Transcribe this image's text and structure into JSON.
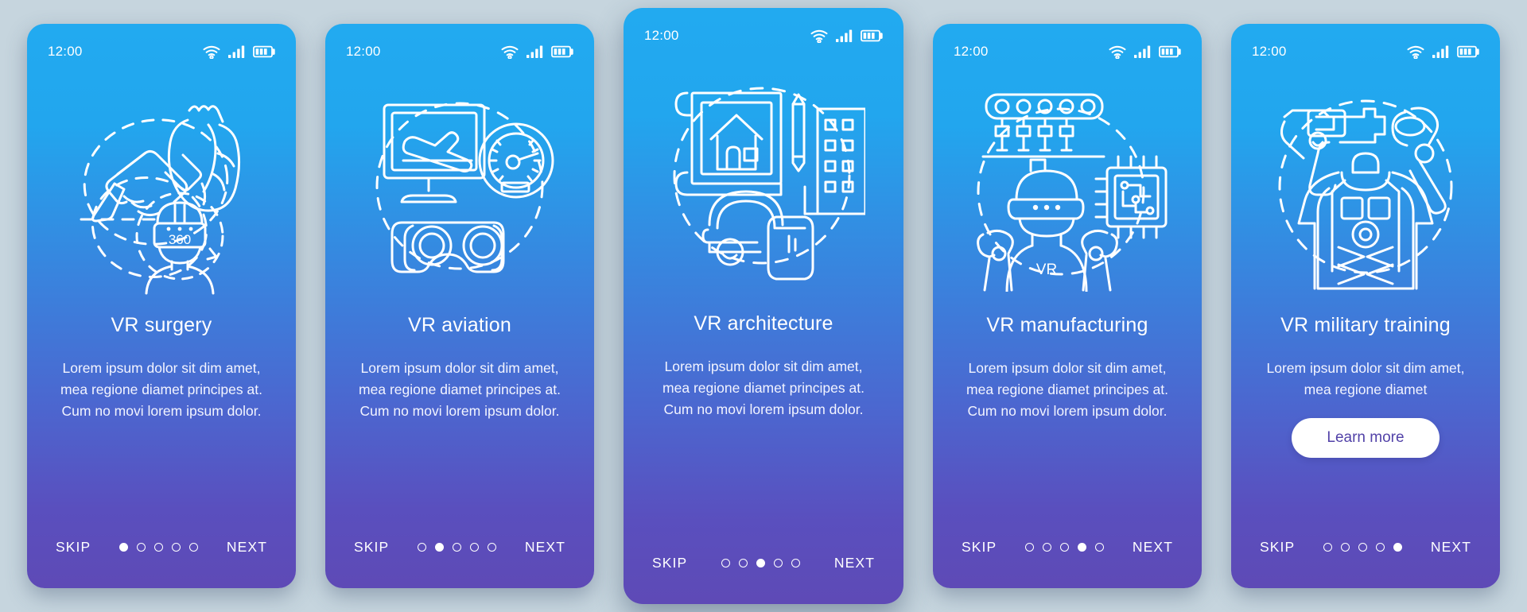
{
  "background_color": "#c6d5de",
  "status_bar": {
    "time": "12:00",
    "wifi_icon": "wifi-icon",
    "signal_icon": "signal-bars-icon",
    "battery_icon": "battery-icon"
  },
  "footer": {
    "skip_label": "SKIP",
    "next_label": "NEXT",
    "total_dots": 5
  },
  "cards": [
    {
      "id": "vr-surgery",
      "title": "VR surgery",
      "body": "Lorem ipsum dolor sit dim amet, mea regione diamet principes at. Cum no movi lorem ipsum dolor.",
      "active_dot": 1,
      "featured": false,
      "illustration": "vr-surgery-illustration",
      "illustration_label": "360",
      "cta": null
    },
    {
      "id": "vr-aviation",
      "title": "VR aviation",
      "body": "Lorem ipsum dolor sit dim amet, mea regione diamet principes at. Cum no movi lorem ipsum dolor.",
      "active_dot": 2,
      "featured": false,
      "illustration": "vr-aviation-illustration",
      "illustration_label": "",
      "cta": null
    },
    {
      "id": "vr-architecture",
      "title": "VR architecture",
      "body": "Lorem ipsum dolor sit dim amet, mea regione diamet principes at. Cum no movi lorem ipsum dolor.",
      "active_dot": 3,
      "featured": true,
      "illustration": "vr-architecture-illustration",
      "illustration_label": "",
      "cta": null
    },
    {
      "id": "vr-manufacturing",
      "title": "VR manufacturing",
      "body": "Lorem ipsum dolor sit dim amet, mea regione diamet principes at. Cum no movi lorem ipsum dolor.",
      "active_dot": 4,
      "featured": false,
      "illustration": "vr-manufacturing-illustration",
      "illustration_label": "VR",
      "cta": null
    },
    {
      "id": "vr-military-training",
      "title": "VR military training",
      "body": "Lorem ipsum dolor sit dim amet, mea regione diamet",
      "active_dot": 5,
      "featured": false,
      "illustration": "vr-military-training-illustration",
      "illustration_label": "",
      "cta": "Learn more"
    }
  ],
  "colors": {
    "gradient_top": "#22aaf0",
    "gradient_bottom": "#5e4ab6",
    "button_bg": "#ffffff",
    "button_text": "#5242a8",
    "stroke": "#ffffff"
  }
}
